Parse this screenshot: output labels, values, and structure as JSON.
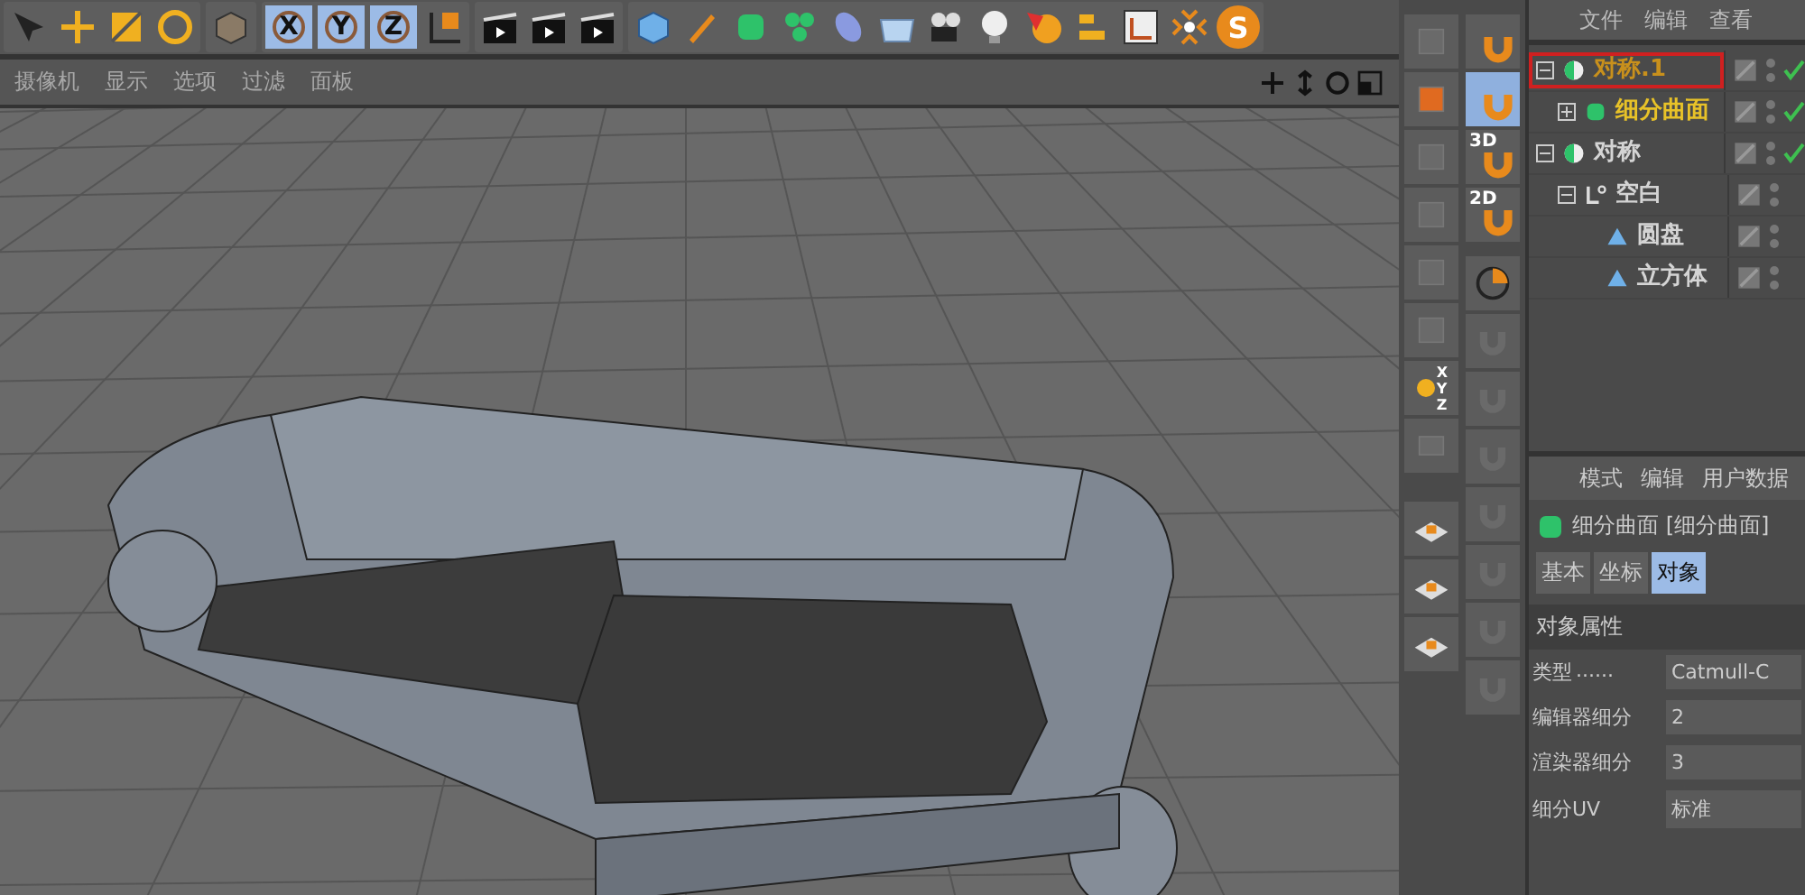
{
  "toolbar": {
    "axis_buttons": [
      {
        "label": "X",
        "selected": true
      },
      {
        "label": "Y",
        "selected": true
      },
      {
        "label": "Z",
        "selected": true
      }
    ],
    "logo_letter": "S"
  },
  "viewport": {
    "menu": [
      "摄像机",
      "显示",
      "选项",
      "过滤",
      "面板"
    ]
  },
  "side_tools": {
    "snap_buttons": [
      {
        "selected": false
      },
      {
        "selected": true
      },
      {
        "label": "3D",
        "selected": false
      },
      {
        "label": "2D",
        "selected": false
      }
    ],
    "axis_letters": [
      "X",
      "Y",
      "Z"
    ]
  },
  "object_manager": {
    "menu": [
      "文件",
      "编辑",
      "查看"
    ],
    "items": [
      {
        "name": "对称.1",
        "kind": "symmetry",
        "selected": true,
        "color": "#c8901c",
        "checked": true,
        "expanded": true,
        "children": [
          {
            "name": "细分曲面",
            "kind": "subdivision",
            "selected": false,
            "color": "#e8c228",
            "checked": true,
            "expanded": false
          }
        ]
      },
      {
        "name": "对称",
        "kind": "symmetry",
        "selected": false,
        "color": "#d4d4d4",
        "checked": true,
        "expanded": true,
        "children": [
          {
            "name": "空白",
            "kind": "null",
            "selected": false,
            "color": "#d4d4d4",
            "checked": false,
            "expanded": true,
            "children": [
              {
                "name": "圆盘",
                "kind": "primitive",
                "selected": false,
                "color": "#d4d4d4",
                "checked": false
              },
              {
                "name": "立方体",
                "kind": "primitive",
                "selected": false,
                "color": "#d4d4d4",
                "checked": false
              }
            ]
          }
        ]
      }
    ]
  },
  "attributes": {
    "menu": [
      "模式",
      "编辑",
      "用户数据"
    ],
    "title": "细分曲面 [细分曲面]",
    "tabs": [
      {
        "label": "基本",
        "selected": false
      },
      {
        "label": "坐标",
        "selected": false
      },
      {
        "label": "对象",
        "selected": true
      }
    ],
    "section": "对象属性",
    "fields": [
      {
        "label": "类型",
        "dots": "......",
        "value": "Catmull-C"
      },
      {
        "label": "编辑器细分",
        "value": "2"
      },
      {
        "label": "渲染器细分",
        "value": "3"
      },
      {
        "label": "细分UV",
        "value": "标准"
      }
    ]
  }
}
